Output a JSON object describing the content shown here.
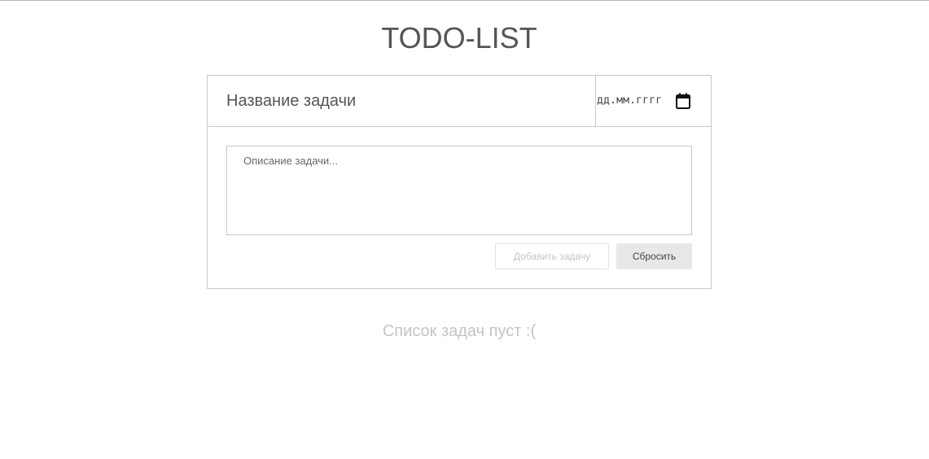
{
  "header": {
    "title": "TODO-LIST"
  },
  "form": {
    "title_placeholder": "Название задачи",
    "date_placeholder": "дд.мм.гггг",
    "date_icon": "calendar-icon",
    "description_placeholder": "Описание задачи...",
    "add_button_label": "Добавить задачу",
    "reset_button_label": "Сбросить"
  },
  "task_list": {
    "empty_message": "Список задач пуст :("
  },
  "colors": {
    "text": "#555555",
    "border": "#c8c8c8",
    "muted": "#c4c4c4",
    "reset_bg": "#e8e8e8"
  }
}
